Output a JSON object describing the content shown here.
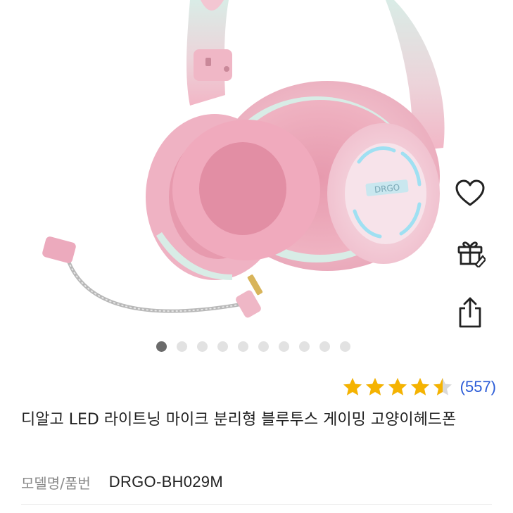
{
  "product": {
    "image_alt": "",
    "gallery": {
      "count": 10,
      "active_index": 0
    },
    "actions": {
      "wishlist_icon": "heart-icon",
      "gift_icon": "gift-icon",
      "share_icon": "share-icon"
    },
    "rating": {
      "value": 4.5,
      "max": 5,
      "review_count": "(557)",
      "star_color": "#f5b301"
    },
    "title": "디알고 LED 라이트닝 마이크 분리형 블루투스 게이밍 고양이헤드폰",
    "model_label": "모델명/품번",
    "model_value": "DRGO-BH029M",
    "colors": {
      "link": "#2a5bd7",
      "pink": "#f0b4c4",
      "mint": "#d8ece6"
    },
    "earcup_brand": "DRGO"
  }
}
